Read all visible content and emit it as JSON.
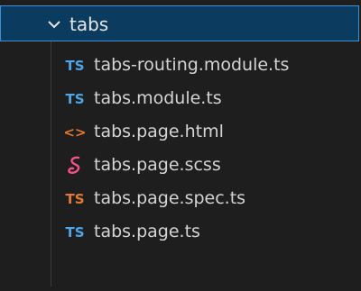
{
  "explorer": {
    "folder": {
      "label": "tabs",
      "expanded": true,
      "icon": "chevron-down-icon"
    },
    "files": [
      {
        "label": "tabs-routing.module.ts",
        "icon_text": "TS",
        "icon": "typescript-icon",
        "icon_color": "#4ca6e8"
      },
      {
        "label": "tabs.module.ts",
        "icon_text": "TS",
        "icon": "typescript-icon",
        "icon_color": "#4ca6e8"
      },
      {
        "label": "tabs.page.html",
        "icon_text": "<>",
        "icon": "html-icon",
        "icon_color": "#e37933"
      },
      {
        "label": "tabs.page.scss",
        "icon_text": "",
        "icon": "sass-icon",
        "icon_color": "#f55385"
      },
      {
        "label": "tabs.page.spec.ts",
        "icon_text": "TS",
        "icon": "typescript-spec-icon",
        "icon_color": "#e37933"
      },
      {
        "label": "tabs.page.ts",
        "icon_text": "TS",
        "icon": "typescript-icon",
        "icon_color": "#4ca6e8"
      }
    ]
  }
}
